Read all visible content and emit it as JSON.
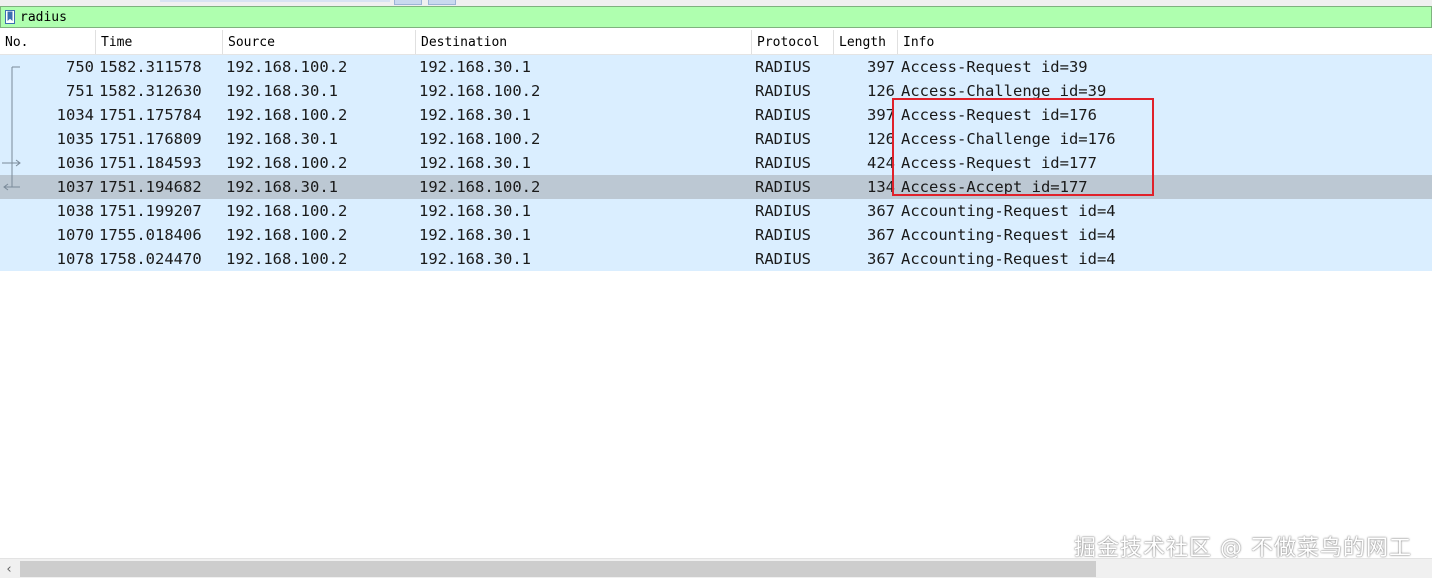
{
  "display_filter": {
    "value": "radius",
    "icon": "bookmark-icon",
    "background_color": "#afffaf"
  },
  "columns": [
    "No.",
    "Time",
    "Source",
    "Destination",
    "Protocol",
    "Length",
    "Info"
  ],
  "packets": [
    {
      "no": "750",
      "time": "1582.311578",
      "source": "192.168.100.2",
      "destination": "192.168.30.1",
      "protocol": "RADIUS",
      "length": "397",
      "info": "Access-Request id=39",
      "related": "start"
    },
    {
      "no": "751",
      "time": "1582.312630",
      "source": "192.168.30.1",
      "destination": "192.168.100.2",
      "protocol": "RADIUS",
      "length": "126",
      "info": "Access-Challenge id=39",
      "related": "line"
    },
    {
      "no": "1034",
      "time": "1751.175784",
      "source": "192.168.100.2",
      "destination": "192.168.30.1",
      "protocol": "RADIUS",
      "length": "397",
      "info": "Access-Request id=176",
      "related": "line"
    },
    {
      "no": "1035",
      "time": "1751.176809",
      "source": "192.168.30.1",
      "destination": "192.168.100.2",
      "protocol": "RADIUS",
      "length": "126",
      "info": "Access-Challenge id=176",
      "related": "line"
    },
    {
      "no": "1036",
      "time": "1751.184593",
      "source": "192.168.100.2",
      "destination": "192.168.30.1",
      "protocol": "RADIUS",
      "length": "424",
      "info": "Access-Request id=177",
      "related": "request"
    },
    {
      "no": "1037",
      "time": "1751.194682",
      "source": "192.168.30.1",
      "destination": "192.168.100.2",
      "protocol": "RADIUS",
      "length": "134",
      "info": "Access-Accept id=177",
      "related": "response",
      "selected": true
    },
    {
      "no": "1038",
      "time": "1751.199207",
      "source": "192.168.100.2",
      "destination": "192.168.30.1",
      "protocol": "RADIUS",
      "length": "367",
      "info": "Accounting-Request id=4",
      "related": "none"
    },
    {
      "no": "1070",
      "time": "1755.018406",
      "source": "192.168.100.2",
      "destination": "192.168.30.1",
      "protocol": "RADIUS",
      "length": "367",
      "info": "Accounting-Request id=4",
      "related": "none"
    },
    {
      "no": "1078",
      "time": "1758.024470",
      "source": "192.168.100.2",
      "destination": "192.168.30.1",
      "protocol": "RADIUS",
      "length": "367",
      "info": "Accounting-Request id=4",
      "related": "none"
    }
  ],
  "colors": {
    "row_background": "#daeeff",
    "selected_row_background": "#bcc8d3",
    "highlight_box": "#e0212a"
  },
  "watermark": "掘金技术社区 @ 不做菜鸟的网工",
  "scrollbar": {
    "left_arrow": "‹"
  }
}
